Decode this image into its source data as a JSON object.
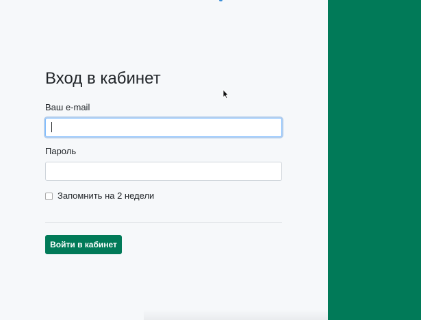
{
  "login": {
    "title": "Вход в кабинет",
    "email_label": "Ваш e-mail",
    "email_value": "",
    "password_label": "Пароль",
    "password_value": "",
    "remember_label": "Запомнить на 2 недели",
    "remember_checked": false,
    "submit_label": "Войти в кабинет"
  },
  "colors": {
    "brand": "#017a58",
    "background": "#f6f8fa",
    "focus_ring": "#80bdff"
  },
  "icons": {
    "pointer": "mouse-pointer-icon"
  }
}
